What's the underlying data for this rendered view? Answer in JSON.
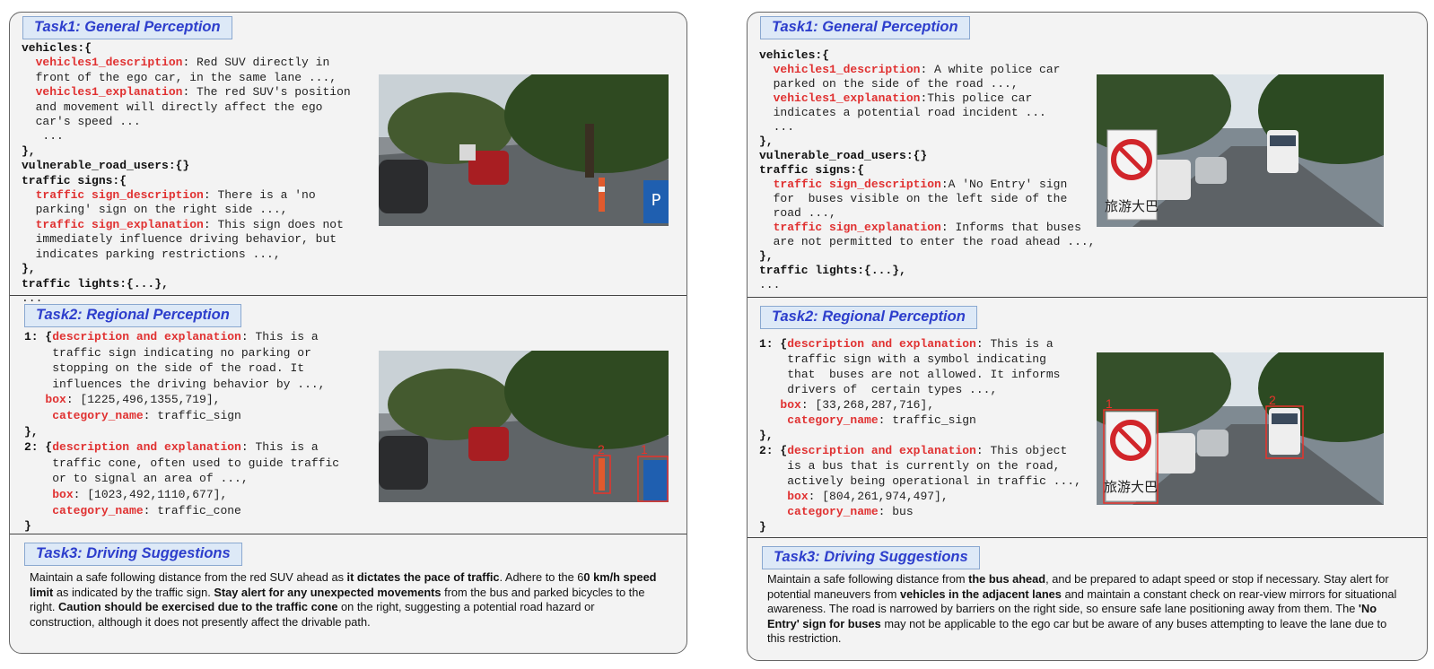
{
  "left": {
    "task1": {
      "title": "Task1: General Perception",
      "l01": "vehicles:{",
      "l02a": "vehicles1_description",
      "l02b": ": Red SUV directly in",
      "l03": "front of the ego car, in the same lane ...,",
      "l04a": "vehicles1_explanation",
      "l04b": ": The red SUV's position",
      "l05": "and movement will directly affect the ego",
      "l06": "car's speed ...",
      "l07": "...",
      "l08": "},",
      "l09": "vulnerable_road_users:{}",
      "l10": "traffic signs:{",
      "l11a": "traffic sign_description",
      "l11b": ": There is a 'no",
      "l12": "parking' sign on the right side ...,",
      "l13a": "traffic sign_explanation",
      "l13b": ": This sign does not",
      "l14": "immediately influence driving behavior, but",
      "l15": "indicates parking restrictions ...,",
      "l16": "},",
      "l17": "traffic lights:{...},",
      "l18": "..."
    },
    "task2": {
      "title": "Task2: Regional Perception",
      "l01a": "1: {",
      "l01b": "description and explanation",
      "l01c": ": This is a",
      "l02": "traffic sign indicating no parking or",
      "l03": "stopping on the side of the road. It",
      "l04": "influences the driving behavior by ...,",
      "l05a": "box",
      "l05b": ": [1225,496,1355,719],",
      "l06a": "category_name",
      "l06b": ": traffic_sign",
      "l07": "},",
      "l08a": "2: {",
      "l08b": "description and explanation",
      "l08c": ": This is a",
      "l09": "traffic cone, often used to guide traffic",
      "l10": "or to signal an area of ...,",
      "l11a": "box",
      "l11b": ": [1023,492,1110,677],",
      "l12a": "category_name",
      "l12b": ": traffic_cone",
      "l13": "}",
      "box_label_1": "1",
      "box_label_2": "2"
    },
    "task3": {
      "title": "Task3: Driving Suggestions",
      "s1": "Maintain a safe following distance from the red SUV ahead as ",
      "s2": "it dictates the pace of traffic",
      "s3": ".  Adhere to the 6",
      "s4": "0 km/h speed limit",
      "s5": " as indicated by the traffic sign.  ",
      "s6": "Stay alert for any unexpected movements",
      "s7": " from the bus and parked bicycles to the right.  ",
      "s8": "Caution should be exercised due to the traffic cone",
      "s9": " on the right, suggesting a potential road hazard or construction, although it does not presently affect the drivable path."
    }
  },
  "right": {
    "task1": {
      "title": "Task1: General Perception",
      "l01": "vehicles:{",
      "l02a": "vehicles1_description",
      "l02b": ": A white police car",
      "l03": "parked on the side of the road ...,",
      "l04a": "vehicles1_explanation",
      "l04b": ":This police car",
      "l05": "indicates a potential road incident ...",
      "l06": "...",
      "l07": "},",
      "l08": "vulnerable_road_users:{}",
      "l09": "traffic signs:{",
      "l10a": "traffic sign_description",
      "l10b": ":A 'No Entry' sign",
      "l11": "for  buses visible on the left side of the",
      "l12": "road ...,",
      "l13a": "traffic sign_explanation",
      "l13b": ": Informs that buses",
      "l14": "are not permitted to enter the road ahead ...,",
      "l15": "},",
      "l16": "traffic lights:{...},",
      "l17": "...",
      "sign_text": "旅游大巴"
    },
    "task2": {
      "title": "Task2: Regional Perception",
      "l01a": "1: {",
      "l01b": "description and explanation",
      "l01c": ": This is a",
      "l02": "traffic sign with a symbol indicating",
      "l03": "that  buses are not allowed. It informs",
      "l04": "drivers of  certain types ...,",
      "l05a": "box",
      "l05b": ": [33,268,287,716],",
      "l06a": "category_name",
      "l06b": ": traffic_sign",
      "l07": "},",
      "l08a": "2: {",
      "l08b": "description and explanation",
      "l08c": ": This object",
      "l09": "is a bus that is currently on the road,",
      "l10": "actively being operational in traffic ...,",
      "l11a": "box",
      "l11b": ": [804,261,974,497],",
      "l12a": "category_name",
      "l12b": ": bus",
      "l13": "}",
      "box_label_1": "1",
      "box_label_2": "2",
      "sign_text": "旅游大巴"
    },
    "task3": {
      "title": "Task3: Driving Suggestions",
      "s1": "Maintain a safe following distance from ",
      "s2": "the bus ahead",
      "s3": ", and be prepared to adapt speed or stop if necessary.  Stay alert for potential maneuvers from ",
      "s4": "vehicles in the adjacent lanes",
      "s5": " and maintain a constant check on rear-view mirrors for situational awareness.  The road is narrowed by barriers on the right side, so ensure safe lane positioning away from them.  The ",
      "s6": "'No Entry' sign for buses",
      "s7": " may not be applicable to the ego car but be aware of any buses attempting to leave the lane due to this restriction."
    }
  },
  "colors": {
    "title_text": "#2d3ecc",
    "title_bg": "#dde9f7",
    "key_red": "#e03131",
    "bbox_red": "#e8332a"
  }
}
